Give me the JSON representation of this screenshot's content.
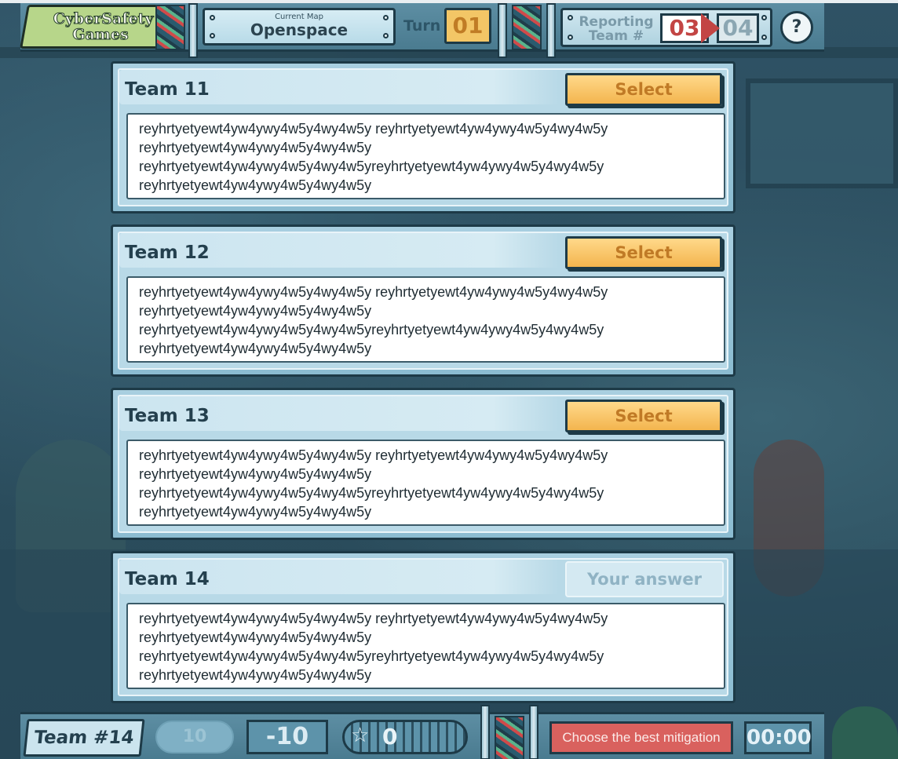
{
  "header": {
    "logo_line1": "CyberSafety",
    "logo_line2": "Games",
    "map_label": "Current Map",
    "map_value": "Openspace",
    "turn_label": "Turn",
    "turn_value": "01",
    "reporting_label": "Reporting Team #",
    "reporting_current": "03",
    "reporting_next": "04",
    "help_label": "?"
  },
  "teams": [
    {
      "title": "Team 11",
      "action": "Select",
      "text": "reyhrtyetyewt4yw4ywy4w5y4wy4w5y reyhrtyetyewt4yw4ywy4w5y4wy4w5y reyhrtyetyewt4yw4ywy4w5y4wy4w5y reyhrtyetyewt4yw4ywy4w5y4wy4w5yreyhrtyetyewt4yw4ywy4w5y4wy4w5y reyhrtyetyewt4yw4ywy4w5y4wy4w5y"
    },
    {
      "title": "Team 12",
      "action": "Select",
      "text": "reyhrtyetyewt4yw4ywy4w5y4wy4w5y reyhrtyetyewt4yw4ywy4w5y4wy4w5y reyhrtyetyewt4yw4ywy4w5y4wy4w5y reyhrtyetyewt4yw4ywy4w5y4wy4w5yreyhrtyetyewt4yw4ywy4w5y4wy4w5y reyhrtyetyewt4yw4ywy4w5y4wy4w5y"
    },
    {
      "title": "Team 13",
      "action": "Select",
      "text": "reyhrtyetyewt4yw4ywy4w5y4wy4w5y reyhrtyetyewt4yw4ywy4w5y4wy4w5y reyhrtyetyewt4yw4ywy4w5y4wy4w5y reyhrtyetyewt4yw4ywy4w5y4wy4w5yreyhrtyetyewt4yw4ywy4w5y4wy4w5y reyhrtyetyewt4yw4ywy4w5y4wy4w5y"
    },
    {
      "title": "Team 14",
      "action": "Your answer",
      "text": "reyhrtyetyewt4yw4ywy4w5y4wy4w5y reyhrtyetyewt4yw4ywy4w5y4wy4w5y reyhrtyetyewt4yw4ywy4w5y4wy4w5y reyhrtyetyewt4yw4ywy4w5y4wy4w5yreyhrtyetyewt4yw4ywy4w5y4wy4w5y reyhrtyetyewt4yw4ywy4w5y4wy4w5y"
    }
  ],
  "footer": {
    "team_tag": "Team #14",
    "coin_value": "10",
    "score": "-10",
    "stars_value": "0",
    "status": "Choose the best mitigation",
    "timer": "00:00"
  },
  "colors": {
    "accent_yellow": "#f3b54e",
    "status_red": "#d9615e",
    "panel_blue": "#a9cfe0"
  }
}
